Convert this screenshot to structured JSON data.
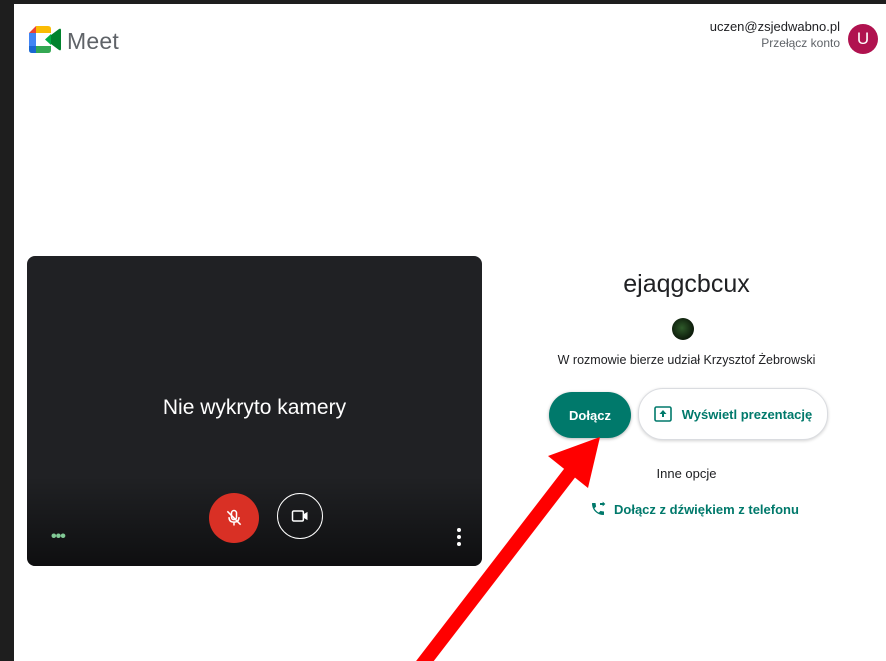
{
  "header": {
    "logo_text": "Meet",
    "account_email": "uczen@zsjedwabno.pl",
    "switch_account_label": "Przełącz konto",
    "avatar_letter": "U",
    "avatar_color": "#b0124f"
  },
  "preview": {
    "status_text": "Nie wykryto kamery",
    "mic_state": "muted",
    "mic_icon": "mic-off-icon",
    "camera_icon": "videocam-icon",
    "more_icon": "more-vert-icon",
    "effects_icon": "more-horiz-icon"
  },
  "join_panel": {
    "meeting_code": "ejaqgcbcux",
    "participants_text": "W rozmowie bierze udział Krzysztof Żebrowski",
    "join_label": "Dołącz",
    "present_label": "Wyświetl prezentację",
    "present_icon": "present-to-all-icon",
    "other_options_label": "Inne opcje",
    "phone_join_label": "Dołącz z dźwiękiem z telefonu",
    "phone_icon": "phone-forwarded-icon"
  },
  "colors": {
    "accent": "#00796b",
    "mic_off": "#d93025",
    "annotation_arrow": "#ff0000"
  }
}
